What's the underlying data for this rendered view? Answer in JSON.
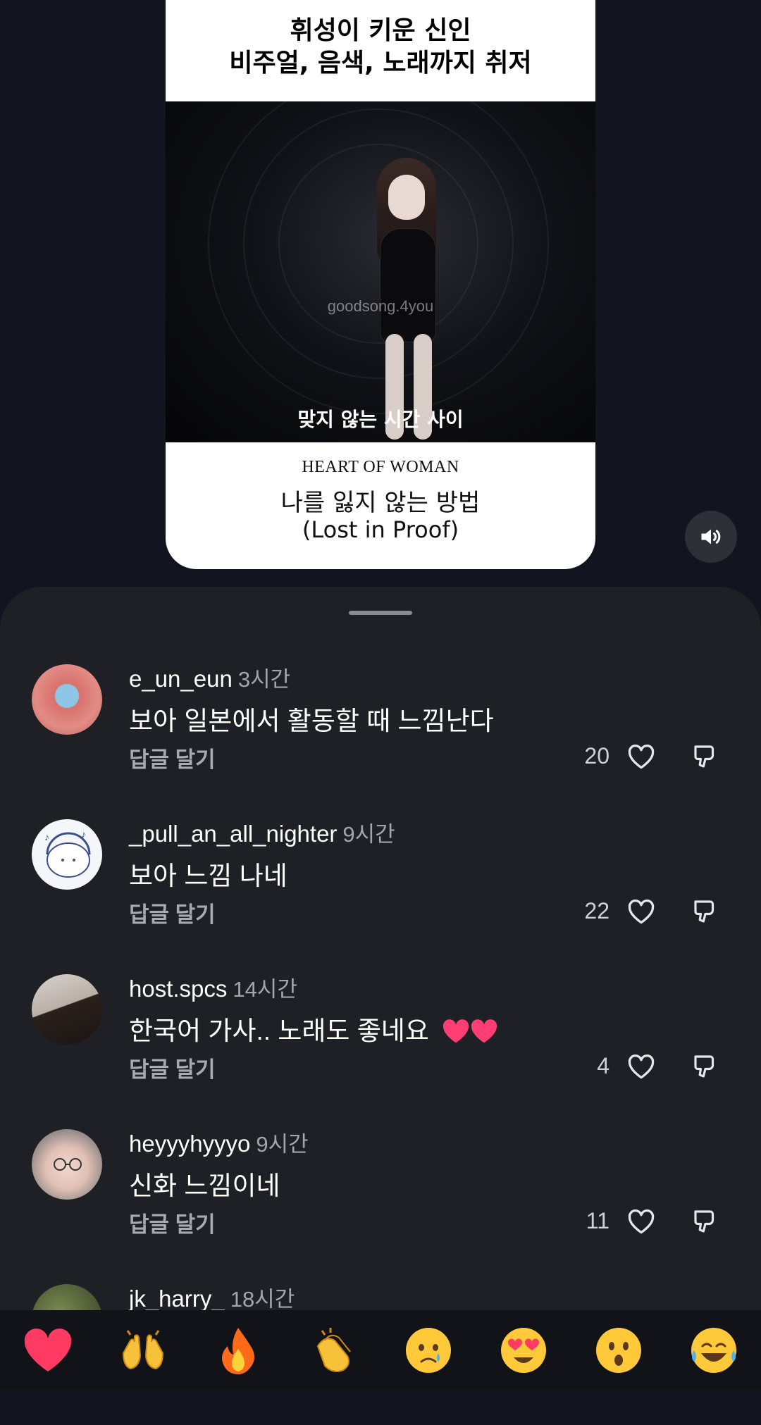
{
  "reel": {
    "header_line1": "휘성이 키운 신인",
    "header_line2": "비주얼, 음색, 노래까지 취저",
    "watermark": "goodsong.4you",
    "caption": "맞지 않는 시간 사이",
    "footer_label": "HEART OF WOMAN",
    "song_title": "나를 잃지 않는 방법",
    "song_subtitle": "(Lost in Proof)"
  },
  "volume_icon": "speaker-icon",
  "comments": [
    {
      "username": "e_un_eun",
      "time": "3시간",
      "text": "보아 일본에서 활동할 때 느낌난다",
      "reply": "답글 달기",
      "likes": "20"
    },
    {
      "username": "_pull_an_all_nighter",
      "time": "9시간",
      "text": "보아 느낌 나네",
      "reply": "답글 달기",
      "likes": "22"
    },
    {
      "username": "host.spcs",
      "time": "14시간",
      "text": "한국어 가사.. 노래도 좋네요",
      "reply": "답글 달기",
      "likes": "4"
    },
    {
      "username": "heyyyhyyyo",
      "time": "9시간",
      "text": "신화 느낌이네",
      "reply": "답글 달기",
      "likes": "11"
    },
    {
      "username": "jk_harry_",
      "time": "18시간"
    }
  ],
  "emoji_bar": [
    "heart",
    "raised-hands",
    "fire",
    "clapping-hands",
    "crying-face",
    "heart-eyes-face",
    "surprised-face",
    "tears-of-joy-face"
  ],
  "colors": {
    "background": "#121520",
    "sheet": "#1f2026",
    "muted_text": "#a4a5ab"
  }
}
